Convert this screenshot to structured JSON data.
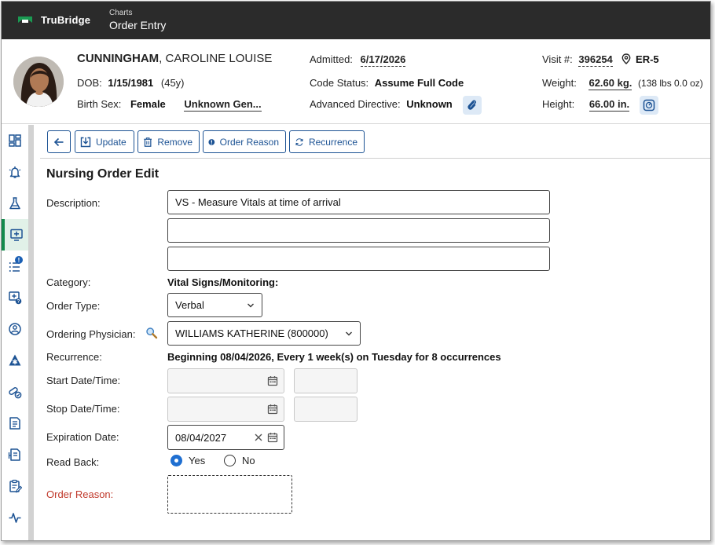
{
  "app": {
    "brand": "TruBridge",
    "breadcrumb_parent": "Charts",
    "breadcrumb_current": "Order Entry",
    "brand_color": "#1a9a52",
    "accent_color": "#1d5394"
  },
  "patient": {
    "last_name": "CUNNINGHAM",
    "first_names": ", CAROLINE LOUISE",
    "dob_label": "DOB:",
    "dob": "1/15/1981",
    "age": "(45y)",
    "sex_label": "Birth Sex:",
    "sex": "Female",
    "gender": "Unknown Gen...",
    "admitted_label": "Admitted:",
    "admitted": "6/17/2026",
    "code_status_label": "Code Status:",
    "code_status": "Assume Full Code",
    "advanced_directive_label": "Advanced Directive:",
    "advanced_directive": "Unknown",
    "visit_label": "Visit #:",
    "visit": "396254",
    "location": "ER-5",
    "weight_label": "Weight:",
    "weight": "62.60 kg.",
    "weight_alt": "(138 lbs 0.0 oz)",
    "height_label": "Height:",
    "height": "66.00 in."
  },
  "nav": {
    "active_index": 3,
    "items": [
      {
        "icon": "dashboard-icon"
      },
      {
        "icon": "alert-bell-icon"
      },
      {
        "icon": "lab-flask-icon"
      },
      {
        "icon": "order-entry-icon"
      },
      {
        "icon": "task-list-icon",
        "badge": "!"
      },
      {
        "icon": "order-question-icon"
      },
      {
        "icon": "care-team-icon"
      },
      {
        "icon": "medical-star-icon"
      },
      {
        "icon": "medication-icon"
      },
      {
        "icon": "document-icon"
      },
      {
        "icon": "report-icon"
      },
      {
        "icon": "notes-edit-icon"
      },
      {
        "icon": "vitals-pulse-icon"
      }
    ]
  },
  "toolbar": {
    "update_label": "Update",
    "remove_label": "Remove",
    "order_reason_label": "Order Reason",
    "recurrence_label": "Recurrence"
  },
  "form": {
    "title": "Nursing Order Edit",
    "description_label": "Description:",
    "description_line1": "VS - Measure Vitals at time of arrival",
    "description_line2": "",
    "description_line3": "",
    "category_label": "Category:",
    "category": "Vital Signs/Monitoring:",
    "order_type_label": "Order Type:",
    "order_type": "Verbal",
    "physician_label": "Ordering Physician:",
    "physician": "WILLIAMS KATHERINE (800000)",
    "recurrence_label": "Recurrence:",
    "recurrence": "Beginning 08/04/2026, Every 1 week(s) on Tuesday for 8 occurrences",
    "start_label": "Start Date/Time:",
    "start_date": "",
    "start_time": "",
    "stop_label": "Stop Date/Time:",
    "stop_date": "",
    "stop_time": "",
    "expiration_label": "Expiration Date:",
    "expiration": "08/04/2027",
    "read_back_label": "Read Back:",
    "read_back_yes": "Yes",
    "read_back_no": "No",
    "read_back_selected": "Yes",
    "order_reason_label": "Order Reason:",
    "order_reason": ""
  }
}
